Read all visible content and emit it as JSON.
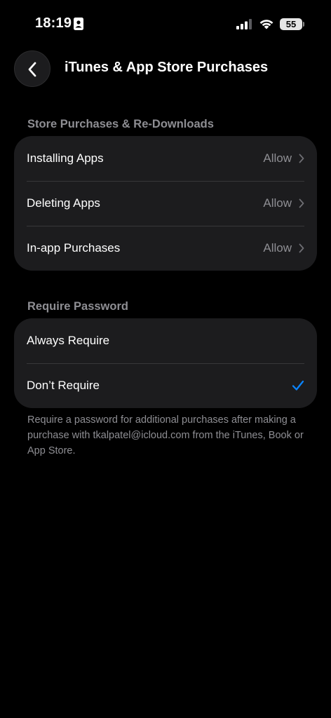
{
  "status_bar": {
    "time": "18:19",
    "battery": "55"
  },
  "header": {
    "title": "iTunes & App Store Purchases"
  },
  "store_section": {
    "header": "Store Purchases & Re-Downloads",
    "rows": [
      {
        "label": "Installing Apps",
        "value": "Allow"
      },
      {
        "label": "Deleting Apps",
        "value": "Allow"
      },
      {
        "label": "In-app Purchases",
        "value": "Allow"
      }
    ]
  },
  "password_section": {
    "header": "Require Password",
    "options": [
      {
        "label": "Always Require",
        "selected": false
      },
      {
        "label": "Don’t Require",
        "selected": true
      }
    ],
    "footer": "Require a password for additional purchases after making a purchase with tkalpatel@icloud.com from the iTunes, Book or App Store."
  },
  "colors": {
    "accent": "#0a84ff",
    "secondary_text": "#8e8e93",
    "group_bg": "#1c1c1e"
  }
}
